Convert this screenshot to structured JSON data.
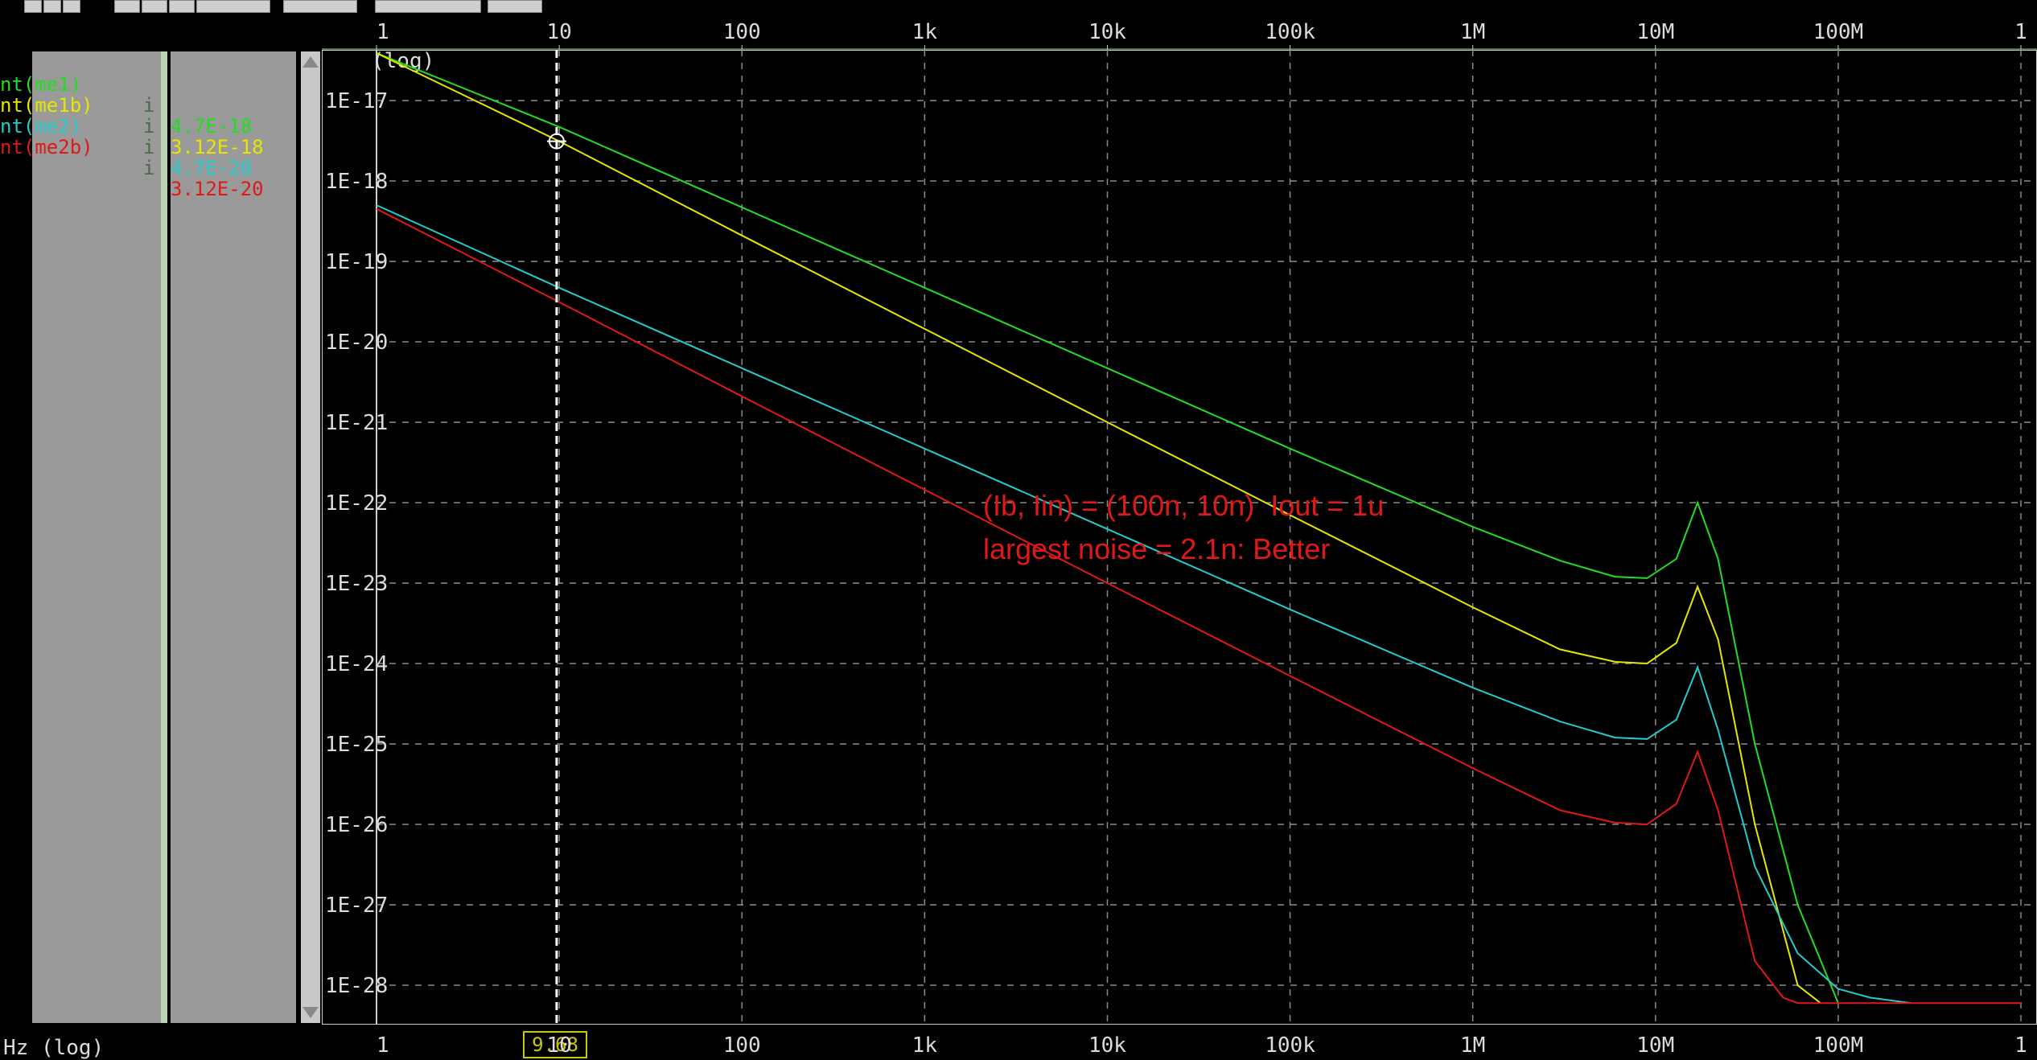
{
  "toolbar": {
    "icons": [
      "run-icon",
      "cursor-icon",
      "zoom-icon",
      "table-icon",
      "chart-icon",
      "scale-icon",
      "measure-icon",
      "close-icon",
      "grid-icon",
      "export-icon"
    ]
  },
  "side_panel": {
    "legend": [
      {
        "name": "nt(me1)",
        "ival": "i",
        "value": "4.7E-18",
        "color": "#22dd22"
      },
      {
        "name": "nt(me1b)",
        "ival": "i",
        "value": "3.12E-18",
        "color": "#e6e600"
      },
      {
        "name": "nt(me2)",
        "ival": "i",
        "value": "4.7E-20",
        "color": "#22cccc"
      },
      {
        "name": "nt(me2b)",
        "ival": "i",
        "value": "3.12E-20",
        "color": "#e01818"
      }
    ]
  },
  "bottom": {
    "x_axis_label": "Hz (log)",
    "cursor_value": "9.68"
  },
  "annotations": {
    "line1": "(Ib, Iin) = (100n, 10n)  Iout = 1u",
    "line2": "largest noise = 2.1n: Better"
  },
  "chart_data": {
    "type": "line",
    "xscale": "log",
    "yscale": "log",
    "y_axis_tag": "(log)",
    "xlim": [
      1,
      1000000000
    ],
    "ylim": [
      6e-29,
      4e-17
    ],
    "x_tick_labels": [
      "1",
      "10",
      "100",
      "1k",
      "10k",
      "100k",
      "1M",
      "10M",
      "100M",
      "1"
    ],
    "y_tick_labels": [
      "1E-17",
      "1E-18",
      "1E-19",
      "1E-20",
      "1E-21",
      "1E-22",
      "1E-23",
      "1E-24",
      "1E-25",
      "1E-26",
      "1E-27",
      "1E-28"
    ],
    "grid": true,
    "cursor_x": 9.68,
    "colors": {
      "background": "#000000",
      "grid": "#8a8a8a",
      "axis": "#cfcfcf",
      "cursor": "#ffffff"
    },
    "series": [
      {
        "name": "nt(me1)",
        "color": "#22dd22",
        "x": [
          1,
          10,
          100,
          1000,
          10000,
          100000,
          1000000,
          3000000,
          6000000,
          9000000,
          13000000,
          17000000,
          22000000,
          35000000,
          60000000,
          100000000
        ],
        "y": [
          4.7e-17,
          4.7e-18,
          4.7e-19,
          4.7e-20,
          4.7e-21,
          4.7e-22,
          5e-23,
          1.9e-23,
          1.2e-23,
          1.15e-23,
          2e-23,
          1e-22,
          2e-23,
          1e-25,
          1e-27,
          6e-29
        ]
      },
      {
        "name": "nt(me1b)",
        "color": "#e6e600",
        "x": [
          1,
          10,
          100,
          1000,
          10000,
          100000,
          1000000,
          3000000,
          6000000,
          9000000,
          13000000,
          17000000,
          22000000,
          35000000,
          60000000,
          80000000
        ],
        "y": [
          4.5e-17,
          3.12e-18,
          2.1e-19,
          1.45e-20,
          1e-21,
          7e-23,
          5e-24,
          1.5e-24,
          1.05e-24,
          1e-24,
          1.8e-24,
          9e-24,
          2e-24,
          1e-26,
          1e-28,
          6e-29
        ]
      },
      {
        "name": "nt(me2)",
        "color": "#22cccc",
        "x": [
          1,
          10,
          100,
          1000,
          10000,
          100000,
          1000000,
          3000000,
          6000000,
          9000000,
          13000000,
          17000000,
          22000000,
          35000000,
          60000000,
          100000000,
          150000000,
          250000000
        ],
        "y": [
          5e-19,
          4.7e-20,
          4.7e-21,
          4.7e-22,
          4.7e-23,
          4.7e-24,
          5e-25,
          1.9e-25,
          1.2e-25,
          1.15e-25,
          2e-25,
          9e-25,
          1.5e-25,
          3e-27,
          2.5e-28,
          9e-29,
          7e-29,
          6e-29
        ]
      },
      {
        "name": "nt(me2b)",
        "color": "#e01818",
        "x": [
          1,
          10,
          100,
          1000,
          10000,
          100000,
          1000000,
          3000000,
          6000000,
          9000000,
          13000000,
          17000000,
          22000000,
          35000000,
          50000000,
          60000000,
          1000000000
        ],
        "y": [
          4.5e-19,
          3.12e-20,
          2.1e-21,
          1.45e-22,
          1e-23,
          7e-25,
          5e-26,
          1.5e-26,
          1.05e-26,
          1e-26,
          1.8e-26,
          8e-26,
          1.5e-26,
          2e-28,
          7e-29,
          6e-29,
          6e-29
        ]
      }
    ]
  }
}
